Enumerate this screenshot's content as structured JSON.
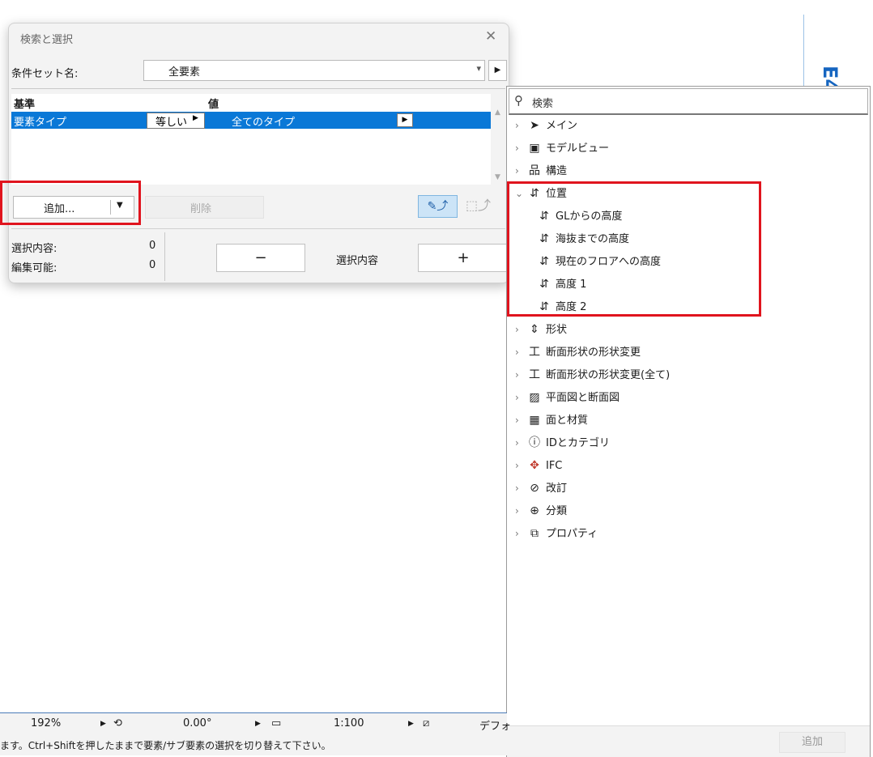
{
  "dialog": {
    "title": "検索と選択",
    "criteria_set_label": "条件セット名:",
    "criteria_set_value": "全要素",
    "table": {
      "headers": [
        "基準",
        "値"
      ],
      "rows": [
        {
          "criterion": "要素タイプ",
          "operator": "等しい",
          "value": "全てのタイプ"
        }
      ]
    },
    "add_label": "追加...",
    "delete_label": "削除",
    "selection_label": "選択内容:",
    "selection_count": "0",
    "editable_label": "編集可能:",
    "editable_count": "0",
    "selection_center_label": "選択内容",
    "minus_label": "−",
    "plus_label": "+"
  },
  "panel": {
    "search_placeholder": "検索",
    "items": [
      {
        "label": "メイン",
        "icon": "cursor-icon",
        "expanded": false
      },
      {
        "label": "モデルビュー",
        "icon": "model-view-icon",
        "expanded": false
      },
      {
        "label": "構造",
        "icon": "structure-icon",
        "expanded": false
      },
      {
        "label": "位置",
        "icon": "position-icon",
        "expanded": true,
        "children": [
          "GLからの高度",
          "海抜までの高度",
          "現在のフロアへの高度",
          "高度 1",
          "高度 2"
        ]
      },
      {
        "label": "形状",
        "icon": "shape-icon",
        "expanded": false
      },
      {
        "label": "断面形状の形状変更",
        "icon": "profile-icon",
        "expanded": false
      },
      {
        "label": "断面形状の形状変更(全て)",
        "icon": "profile-icon",
        "expanded": false
      },
      {
        "label": "平面図と断面図",
        "icon": "floorplan-icon",
        "expanded": false
      },
      {
        "label": "面と材質",
        "icon": "surface-icon",
        "expanded": false
      },
      {
        "label": "IDとカテゴリ",
        "icon": "id-icon",
        "expanded": false
      },
      {
        "label": "IFC",
        "icon": "ifc-icon",
        "expanded": false
      },
      {
        "label": "改訂",
        "icon": "revision-icon",
        "expanded": false
      },
      {
        "label": "分類",
        "icon": "classification-icon",
        "expanded": false
      },
      {
        "label": "プロパティ",
        "icon": "property-icon",
        "expanded": false
      }
    ],
    "add_label": "追加"
  },
  "statusbar": {
    "zoom": "192%",
    "angle": "0.00°",
    "scale": "1:100",
    "layer_partial": "デフォ",
    "hint": "ます。Ctrl+Shiftを押したままで要素/サブ要素の選択を切り替えて下さい。"
  },
  "colors": {
    "highlight": "#e0141e",
    "selection": "#0a78d7"
  }
}
